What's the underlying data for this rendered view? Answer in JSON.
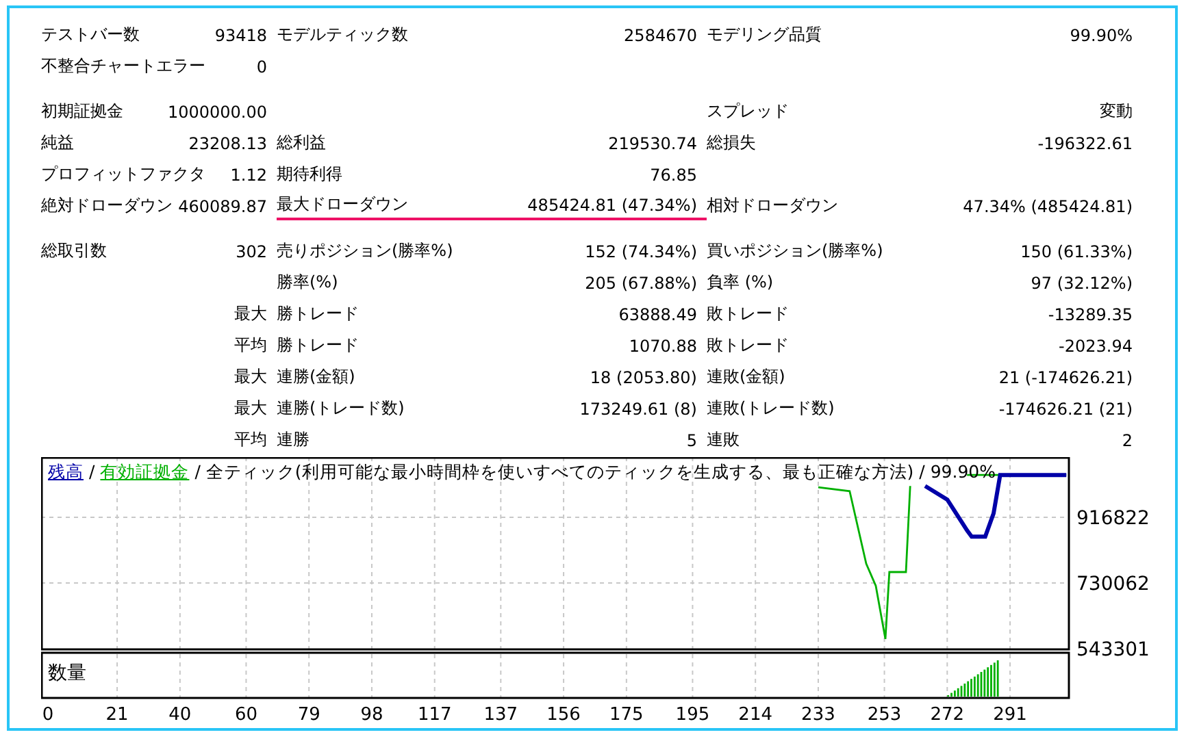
{
  "stats": {
    "sections": [
      {
        "rows": [
          [
            {
              "label": "テストバー数",
              "value": "93418",
              "highlighted": false
            },
            {
              "label": "モデルティック数",
              "value": "2584670",
              "highlighted": false
            },
            {
              "label": "モデリング品質",
              "value": "99.90%",
              "highlighted": false
            }
          ],
          [
            {
              "label": "不整合チャートエラー",
              "value": "0",
              "highlighted": false
            }
          ]
        ]
      },
      {
        "rows": [
          [
            {
              "label": "初期証拠金",
              "value": "1000000.00",
              "highlighted": false
            },
            {
              "highlighted": false
            },
            {
              "label": "スプレッド",
              "value": "変動",
              "highlighted": false
            }
          ],
          [
            {
              "label": "純益",
              "value": "23208.13",
              "highlighted": false
            },
            {
              "label": "総利益",
              "value": "219530.74",
              "highlighted": false
            },
            {
              "label": "総損失",
              "value": "-196322.61",
              "highlighted": false
            }
          ],
          [
            {
              "label": "プロフィットファクタ",
              "value": "1.12",
              "highlighted": false
            },
            {
              "label": "期待利得",
              "value": "76.85",
              "highlighted": false
            }
          ],
          [
            {
              "label": "絶対ドローダウン",
              "value": "460089.87",
              "highlighted": false
            },
            {
              "label": "最大ドローダウン",
              "value": "485424.81 (47.34%)",
              "highlighted": true
            },
            {
              "label": "相対ドローダウン",
              "value": "47.34% (485424.81)",
              "highlighted": false
            }
          ]
        ]
      },
      {
        "rows": [
          [
            {
              "label": "総取引数",
              "value": "302",
              "highlighted": false
            },
            {
              "label": "売りポジション(勝率%)",
              "value": "152 (74.34%)",
              "highlighted": false
            },
            {
              "label": "買いポジション(勝率%)",
              "value": "150 (61.33%)",
              "highlighted": false
            }
          ],
          [
            {
              "highlighted": false
            },
            {
              "label": "勝率(%)",
              "value": "205 (67.88%)",
              "highlighted": false
            },
            {
              "label": "負率 (%)",
              "value": "97 (32.12%)",
              "highlighted": false
            }
          ],
          [
            {
              "value": "最大",
              "highlighted": false
            },
            {
              "label": "勝トレード",
              "value": "63888.49",
              "highlighted": false
            },
            {
              "label": "敗トレード",
              "value": "-13289.35",
              "highlighted": false
            }
          ],
          [
            {
              "value": "平均",
              "highlighted": false
            },
            {
              "label": "勝トレード",
              "value": "1070.88",
              "highlighted": false
            },
            {
              "label": "敗トレード",
              "value": "-2023.94",
              "highlighted": false
            }
          ],
          [
            {
              "value": "最大",
              "highlighted": false
            },
            {
              "label": "連勝(金額)",
              "value": "18 (2053.80)",
              "highlighted": false
            },
            {
              "label": "連敗(金額)",
              "value": "21 (-174626.21)",
              "highlighted": false
            }
          ],
          [
            {
              "value": "最大",
              "highlighted": false
            },
            {
              "label": "連勝(トレード数)",
              "value": "173249.61 (8)",
              "highlighted": false
            },
            {
              "label": "連敗(トレード数)",
              "value": "-174626.21 (21)",
              "highlighted": false
            }
          ],
          [
            {
              "value": "平均",
              "highlighted": false
            },
            {
              "label": "連勝",
              "value": "5",
              "highlighted": false
            },
            {
              "label": "連敗",
              "value": "2",
              "highlighted": false
            }
          ]
        ]
      }
    ]
  },
  "chart": {
    "separator": "/",
    "caption": "/ 全ティック(利用可能な最小時間枠を使いすべてのティックを生成する、最も正確な方法) / 99.90%",
    "volume_label": "数量",
    "chart_data": {
      "type": "line",
      "x": [
        233,
        242.5,
        247.5,
        250.4,
        253.3,
        254.5,
        259.5,
        260.8,
        265.3,
        272,
        278,
        279.4,
        283.5,
        286,
        288,
        308
      ],
      "series": [
        {
          "name": "残高",
          "color": "#0000a8",
          "values": [
            null,
            null,
            null,
            null,
            null,
            null,
            null,
            null,
            1006000,
            967000,
            880000,
            862000,
            862000,
            928000,
            1037000,
            1037000
          ]
        },
        {
          "name": "有効証拠金",
          "color": "#00b000",
          "values": [
            1002000,
            991000,
            785000,
            722000,
            571000,
            761000,
            761000,
            1006000,
            null,
            null,
            1037000,
            1037000,
            1037000,
            1037000,
            1037000,
            1037000
          ]
        }
      ],
      "grid": true,
      "xlim": [
        -2,
        309
      ],
      "ylim": [
        543301,
        1088014
      ],
      "xticks": [
        0,
        21,
        40,
        60,
        79,
        98,
        117,
        137,
        156,
        175,
        195,
        214,
        233,
        253,
        272,
        291
      ],
      "yticks": [
        916822,
        730062,
        543301
      ]
    }
  }
}
